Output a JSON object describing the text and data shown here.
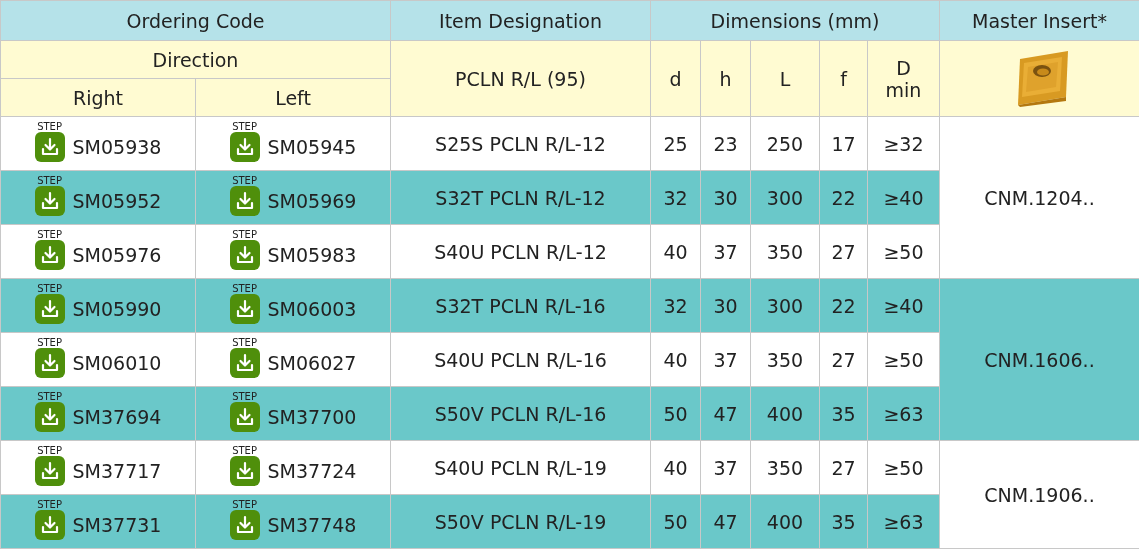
{
  "header": {
    "ordering_code": "Ordering Code",
    "item_designation": "Item Designation",
    "dimensions": "Dimensions (mm)",
    "master_insert": "Master Insert*",
    "direction": "Direction",
    "right": "Right",
    "left": "Left",
    "designation_family": "PCLN R/L (95)",
    "dimension_columns": [
      "d",
      "h",
      "L",
      "f",
      "D min"
    ]
  },
  "groups": [
    {
      "insert": "CNM.1204..",
      "highlighted": false,
      "rows": [
        {
          "highlighted": false,
          "right": {
            "badge": "STEP",
            "code": "SM05938"
          },
          "left": {
            "badge": "STEP",
            "code": "SM05945"
          },
          "designation": "S25S PCLN R/L-12",
          "dims": [
            "25",
            "23",
            "250",
            "17",
            "≥32"
          ]
        },
        {
          "highlighted": true,
          "right": {
            "badge": "STEP",
            "code": "SM05952"
          },
          "left": {
            "badge": "STEP",
            "code": "SM05969"
          },
          "designation": "S32T PCLN R/L-12",
          "dims": [
            "32",
            "30",
            "300",
            "22",
            "≥40"
          ]
        },
        {
          "highlighted": false,
          "right": {
            "badge": "STEP",
            "code": "SM05976"
          },
          "left": {
            "badge": "STEP",
            "code": "SM05983"
          },
          "designation": "S40U PCLN R/L-12",
          "dims": [
            "40",
            "37",
            "350",
            "27",
            "≥50"
          ]
        }
      ]
    },
    {
      "insert": "CNM.1606..",
      "highlighted": true,
      "rows": [
        {
          "highlighted": true,
          "right": {
            "badge": "STEP",
            "code": "SM05990"
          },
          "left": {
            "badge": "STEP",
            "code": "SM06003"
          },
          "designation": "S32T PCLN R/L-16",
          "dims": [
            "32",
            "30",
            "300",
            "22",
            "≥40"
          ]
        },
        {
          "highlighted": false,
          "right": {
            "badge": "STEP",
            "code": "SM06010"
          },
          "left": {
            "badge": "STEP",
            "code": "SM06027"
          },
          "designation": "S40U PCLN R/L-16",
          "dims": [
            "40",
            "37",
            "350",
            "27",
            "≥50"
          ]
        },
        {
          "highlighted": true,
          "right": {
            "badge": "STEP",
            "code": "SM37694"
          },
          "left": {
            "badge": "STEP",
            "code": "SM37700"
          },
          "designation": "S50V PCLN R/L-16",
          "dims": [
            "50",
            "47",
            "400",
            "35",
            "≥63"
          ]
        }
      ]
    },
    {
      "insert": "CNM.1906..",
      "highlighted": false,
      "rows": [
        {
          "highlighted": false,
          "right": {
            "badge": "STEP",
            "code": "SM37717"
          },
          "left": {
            "badge": "STEP",
            "code": "SM37724"
          },
          "designation": "S40U PCLN R/L-19",
          "dims": [
            "40",
            "37",
            "350",
            "27",
            "≥50"
          ]
        },
        {
          "highlighted": true,
          "right": {
            "badge": "STEP",
            "code": "SM37731"
          },
          "left": {
            "badge": "STEP",
            "code": "SM37748"
          },
          "designation": "S50V PCLN R/L-19",
          "dims": [
            "50",
            "47",
            "400",
            "35",
            "≥63"
          ]
        }
      ]
    }
  ]
}
